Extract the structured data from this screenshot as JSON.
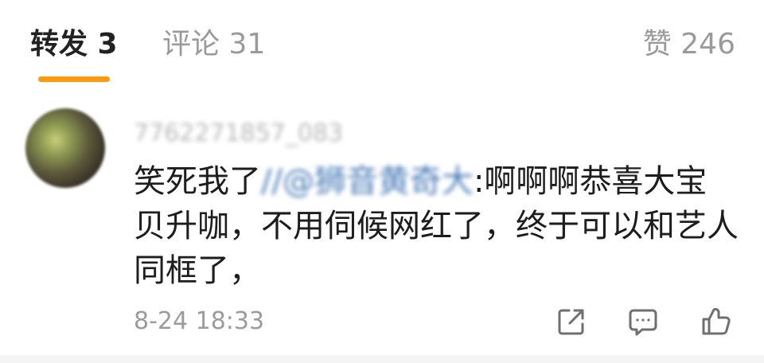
{
  "tabs": {
    "forward_label": "转发 3",
    "comment_label": "评论 31",
    "like_label": "赞 246"
  },
  "comment": {
    "username": "7762271857_083",
    "text_before": "笑死我了",
    "mention": "//@狮音黄奇大",
    "text_after": ":啊啊啊恭喜大宝贝升咖，不用伺候网红了，终于可以和艺人同框了，",
    "timestamp": "8-24 18:33"
  },
  "icons": {
    "share": "share-icon",
    "reply": "reply-icon",
    "like": "thumbs-up-icon"
  },
  "colors": {
    "accent": "#ff9a0d",
    "text": "#1d1d1d",
    "muted": "#9b9b9b",
    "mention": "#4a7cb8"
  }
}
